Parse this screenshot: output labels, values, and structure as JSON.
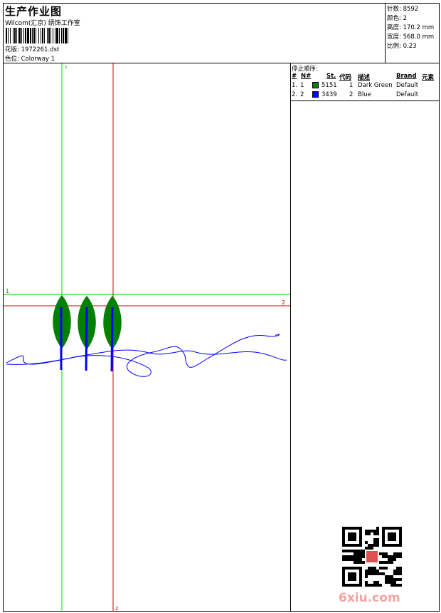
{
  "header": {
    "title": "生产作业图",
    "studio": "Wilcom(汇京) 绣饰工作室",
    "design_label": "花版:",
    "design_value": "1972261.dst",
    "colorway_label": "色位:",
    "colorway_value": "Colorway 1"
  },
  "stats": {
    "stitches_label": "针数:",
    "stitches_value": "8592",
    "colors_label": "颜色:",
    "colors_value": "2",
    "height_label": "高度:",
    "height_value": "170.2 mm",
    "width_label": "宽度:",
    "width_value": "568.0 mm",
    "scale_label": "比例:",
    "scale_value": "0.23"
  },
  "stops": {
    "title": "停止顺序:",
    "columns": [
      "#",
      "N#",
      "St.",
      "代码",
      "描述",
      "Brand",
      "元素"
    ],
    "rows": [
      {
        "num": "1.",
        "n": "1",
        "color": "#008000",
        "st": "5151",
        "code": "1",
        "desc": "Dark Green",
        "brand": "Default"
      },
      {
        "num": "2.",
        "n": "2",
        "color": "#0000ff",
        "st": "3439",
        "code": "2",
        "desc": "Blue",
        "brand": "Default"
      }
    ]
  },
  "canvas": {
    "guide_green_h_label": "1",
    "guide_red_h_label": "2",
    "guide_green_v_label": "1",
    "guide_red_v_label": "2",
    "green_color": "#00cc00",
    "red_color": "#cc0000",
    "leaf_color": "#008000",
    "thread_color": "#0000ff"
  },
  "watermark": {
    "text": "6xiu.com"
  }
}
